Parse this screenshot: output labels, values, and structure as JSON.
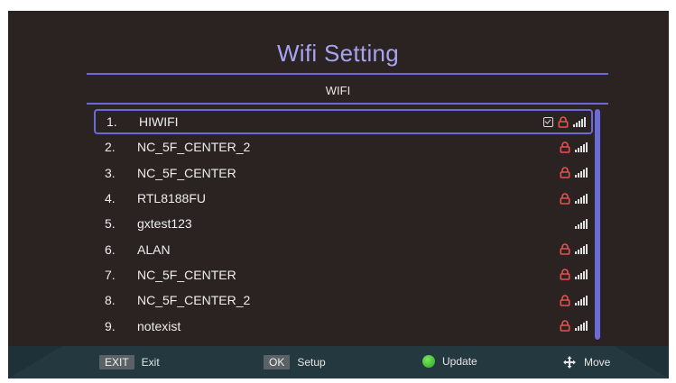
{
  "header": {
    "title": "Wifi Setting",
    "subtitle": "WIFI"
  },
  "colors": {
    "accent": "#6c6ad7",
    "title": "#a7a3f0",
    "lock": "#e8514f",
    "background": "#2a2322",
    "update_dot": "#3bb02b"
  },
  "networks": [
    {
      "num": "1.",
      "name": "HIWIFI",
      "connected": true,
      "locked": true,
      "selected": true
    },
    {
      "num": "2.",
      "name": "NC_5F_CENTER_2",
      "connected": false,
      "locked": true,
      "selected": false
    },
    {
      "num": "3.",
      "name": "NC_5F_CENTER",
      "connected": false,
      "locked": true,
      "selected": false
    },
    {
      "num": "4.",
      "name": "RTL8188FU",
      "connected": false,
      "locked": true,
      "selected": false
    },
    {
      "num": "5.",
      "name": "gxtest123",
      "connected": false,
      "locked": false,
      "selected": false
    },
    {
      "num": "6.",
      "name": "ALAN",
      "connected": false,
      "locked": true,
      "selected": false
    },
    {
      "num": "7.",
      "name": "NC_5F_CENTER",
      "connected": false,
      "locked": true,
      "selected": false
    },
    {
      "num": "8.",
      "name": "NC_5F_CENTER_2",
      "connected": false,
      "locked": true,
      "selected": false
    },
    {
      "num": "9.",
      "name": "notexist",
      "connected": false,
      "locked": true,
      "selected": false
    }
  ],
  "footer": {
    "exit_key": "EXIT",
    "exit_label": "Exit",
    "ok_key": "OK",
    "ok_label": "Setup",
    "update_label": "Update",
    "move_label": "Move"
  }
}
